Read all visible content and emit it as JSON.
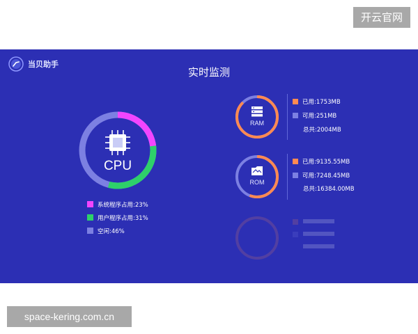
{
  "watermarks": {
    "top": "开云官网",
    "bottom": "space-kering.com.cn"
  },
  "app": {
    "brand_name": "当贝助手",
    "brand_icon": "dangbei-logo-icon",
    "title": "实时监测"
  },
  "colors": {
    "background": "#2c2fb4",
    "system": "#f245ff",
    "user": "#2ed06a",
    "idle": "#7c80e2",
    "used": "#ff8a52",
    "available": "#7c80e2"
  },
  "cpu": {
    "label": "CPU",
    "icon": "cpu-chip-icon",
    "system_pct": 23,
    "user_pct": 31,
    "idle_pct": 46,
    "legend": [
      {
        "label": "系统程序占用:23%"
      },
      {
        "label": "用户程序占用:31%"
      },
      {
        "label": "空闲:46%"
      }
    ]
  },
  "ram": {
    "label": "RAM",
    "icon": "ram-stack-icon",
    "used_fraction": 0.875,
    "used": "已用:1753MB",
    "available": "可用:251MB",
    "total": "总共:2004MB"
  },
  "rom": {
    "label": "ROM",
    "icon": "rom-folder-icon",
    "used_fraction": 0.558,
    "used": "已用:9135.55MB",
    "available": "可用:7248.45MB",
    "total": "总共:16384.00MB"
  }
}
